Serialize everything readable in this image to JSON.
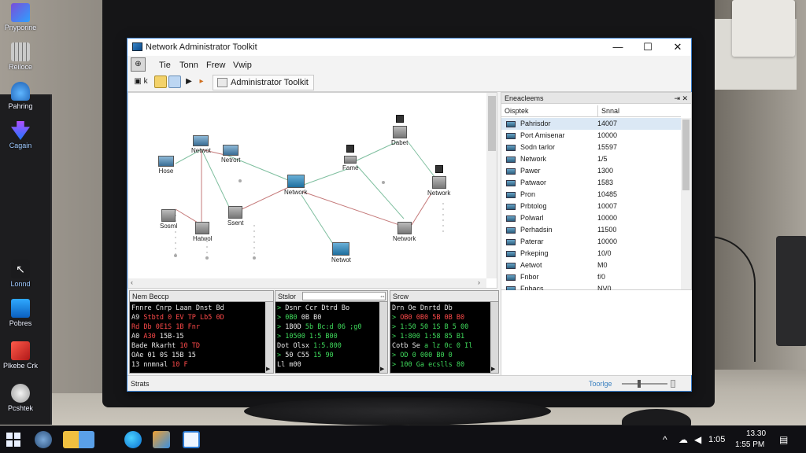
{
  "desktop_icons": [
    {
      "label": "Pnyporine",
      "icon": "video-app-icon"
    },
    {
      "label": "Reiloce",
      "icon": "grid-app-icon"
    },
    {
      "label": "Pahring",
      "icon": "cloud-app-icon"
    },
    {
      "label": "Cagain",
      "icon": "arrow-app-icon"
    },
    {
      "label": "Lonnd",
      "icon": "cursor-app-icon"
    },
    {
      "label": "Pobres",
      "icon": "chart-app-icon"
    },
    {
      "label": "Plkebe Crk",
      "icon": "box-app-icon"
    },
    {
      "label": "Pcshtek",
      "icon": "circle-app-icon"
    }
  ],
  "window": {
    "title": "Network Administrator Toolkit",
    "controls": {
      "minimize": "—",
      "maximize": "☐",
      "close": "✕"
    }
  },
  "menu": {
    "badge": "⊕",
    "items": [
      "Tie",
      "Tonn",
      "Frew",
      "Vwip"
    ]
  },
  "toolbar": {
    "admin_label": "Administrator Toolkit",
    "btn1": "▣ k",
    "btn4": "▶",
    "btn5": "▸"
  },
  "canvas": {
    "nodes": [
      "Hose",
      "Netwot",
      "Netrort",
      "Network",
      "Fame",
      "Dabet",
      "Network",
      "Sosml",
      "Hatwol",
      "Ssent",
      "Network",
      "Netwot"
    ],
    "scroll_left": "‹",
    "scroll_right": "›"
  },
  "properties": {
    "header": "Eneacleems",
    "pin": "⇥",
    "close": "✕",
    "col_name": "Oisptek",
    "col_value": "Snnal",
    "rows": [
      {
        "name": "Pahrisdor",
        "value": "14007",
        "selected": true
      },
      {
        "name": "Port Amisenar",
        "value": "10000",
        "selected": false
      },
      {
        "name": "Sodn tarlor",
        "value": "15597",
        "selected": false
      },
      {
        "name": "Network",
        "value": "1/5",
        "selected": false
      },
      {
        "name": "Pawer",
        "value": "1300",
        "selected": false
      },
      {
        "name": "Patwaor",
        "value": "1583",
        "selected": false
      },
      {
        "name": "Pron",
        "value": "10485",
        "selected": false
      },
      {
        "name": "Prbtolog",
        "value": "10007",
        "selected": false
      },
      {
        "name": "Polwarl",
        "value": "10000",
        "selected": false
      },
      {
        "name": "Perhadsin",
        "value": "11500",
        "selected": false
      },
      {
        "name": "Paterar",
        "value": "10000",
        "selected": false
      },
      {
        "name": "Prkeping",
        "value": "10/0",
        "selected": false
      },
      {
        "name": "Aetwot",
        "value": "M0",
        "selected": false
      },
      {
        "name": "Fnbor",
        "value": "f/0",
        "selected": false
      },
      {
        "name": "Fnbacs",
        "value": "NV0",
        "selected": false
      }
    ]
  },
  "panes": [
    {
      "header": "Nem Beccp",
      "lines": [
        [
          {
            "t": "Fnnre Cnrp",
            "c": "w"
          },
          {
            "t": "   Laan Dnst Bd",
            "c": "w"
          }
        ],
        [
          {
            "t": "A9  ",
            "c": "w"
          },
          {
            "t": "Stbtd 0 EV TP",
            "c": "r"
          },
          {
            "t": "  Lb5 0D",
            "c": "r"
          }
        ],
        [
          {
            "t": "Rd Db 0E1S",
            "c": "r"
          },
          {
            "t": "     1B Fnr",
            "c": "r"
          }
        ],
        [
          {
            "t": "A0  ",
            "c": "w"
          },
          {
            "t": "A30",
            "c": "r"
          },
          {
            "t": "        15B-15",
            "c": "w"
          }
        ],
        [
          {
            "t": "Bade Rkarht",
            "c": "w"
          },
          {
            "t": "      10 TD",
            "c": "r"
          }
        ],
        [
          {
            "t": "OAe 01 0S",
            "c": "w"
          },
          {
            "t": "        15B 15",
            "c": "w"
          }
        ],
        [
          {
            "t": "13 nnmnal",
            "c": "w"
          },
          {
            "t": "        10 F",
            "c": "r"
          }
        ]
      ]
    },
    {
      "header": "Stslor",
      "lines": [
        [
          {
            "t": "> ",
            "c": "g"
          },
          {
            "t": "Dsnr Ccr",
            "c": "w"
          },
          {
            "t": "     Dtrd Bo",
            "c": "w"
          }
        ],
        [
          {
            "t": "> ",
            "c": "g"
          },
          {
            "t": "0B0",
            "c": "g"
          },
          {
            "t": "        0B B0",
            "c": "w"
          }
        ],
        [
          {
            "t": "> ",
            "c": "g"
          },
          {
            "t": "1B0D",
            "c": "w"
          },
          {
            "t": "  5b Bc:d 06 ;g0",
            "c": "g"
          }
        ],
        [
          {
            "t": "> ",
            "c": "g"
          },
          {
            "t": "10500",
            "c": "g"
          },
          {
            "t": "      1:5 B00",
            "c": "g"
          }
        ],
        [
          {
            "t": "  ",
            "c": "g"
          },
          {
            "t": "Dot Olsx",
            "c": "w"
          },
          {
            "t": "     1:5.800",
            "c": "g"
          }
        ],
        [
          {
            "t": "> ",
            "c": "g"
          },
          {
            "t": "50 C55",
            "c": "w"
          },
          {
            "t": "      15 90",
            "c": "g"
          }
        ],
        [
          {
            "t": "  ",
            "c": "g"
          },
          {
            "t": "Ll m00",
            "c": "w"
          },
          {
            "t": "",
            "c": "w"
          }
        ]
      ]
    },
    {
      "header": "Srcw",
      "lines": [
        [
          {
            "t": "  ",
            "c": "g"
          },
          {
            "t": "Drn Oe",
            "c": "w"
          },
          {
            "t": "       Dnrtd Db",
            "c": "w"
          }
        ],
        [
          {
            "t": "> ",
            "c": "g"
          },
          {
            "t": "OB0 0B0",
            "c": "r"
          },
          {
            "t": "     5B 0B B0",
            "c": "r"
          }
        ],
        [
          {
            "t": "> ",
            "c": "g"
          },
          {
            "t": "1:50 50",
            "c": "g"
          },
          {
            "t": "     1S B 5 00",
            "c": "g"
          }
        ],
        [
          {
            "t": "> ",
            "c": "g"
          },
          {
            "t": "1:800",
            "c": "g"
          },
          {
            "t": "     1:58 85 B1",
            "c": "g"
          }
        ],
        [
          {
            "t": "  ",
            "c": "g"
          },
          {
            "t": "Cotb Se",
            "c": "w"
          },
          {
            "t": "     a lz 0c 0 Il",
            "c": "g"
          }
        ],
        [
          {
            "t": "> ",
            "c": "g"
          },
          {
            "t": "OD 0",
            "c": "g"
          },
          {
            "t": "      000 B0 0",
            "c": "g"
          }
        ],
        [
          {
            "t": "> ",
            "c": "g"
          },
          {
            "t": "100 Ga",
            "c": "g"
          },
          {
            "t": "     ecslls 80",
            "c": "g"
          }
        ]
      ]
    }
  ],
  "statusbar": {
    "left": "Strats",
    "zoom_label": "Toorlge"
  },
  "taskbar": {
    "tray_time": "1:05",
    "clock_time": "13.30",
    "clock_date": "1:55 PM",
    "up_arrow": "^",
    "network": "☁",
    "volume": "◀",
    "notifications": "▤"
  }
}
